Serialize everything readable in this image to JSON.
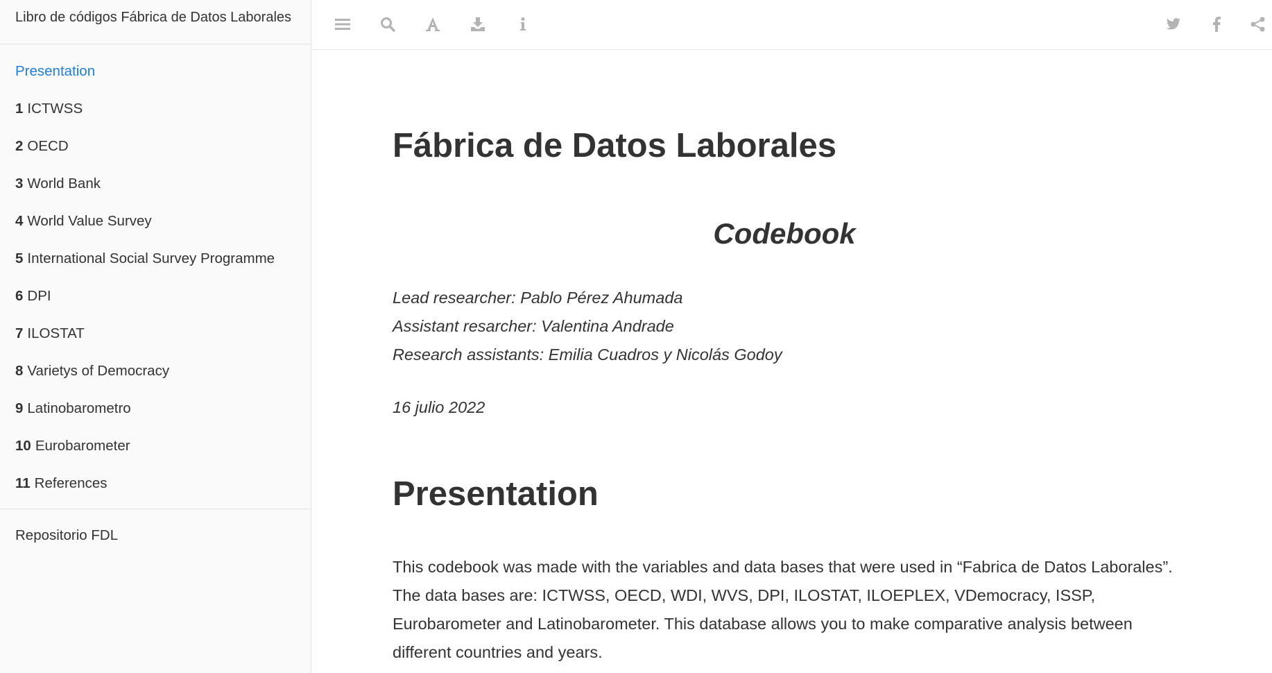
{
  "sidebar": {
    "title": "Libro de códigos Fábrica de Datos Laborales",
    "items": [
      {
        "num": "",
        "label": "Presentation",
        "active": true
      },
      {
        "num": "1",
        "label": "ICTWSS",
        "active": false
      },
      {
        "num": "2",
        "label": "OECD",
        "active": false
      },
      {
        "num": "3",
        "label": "World Bank",
        "active": false
      },
      {
        "num": "4",
        "label": "World Value Survey",
        "active": false
      },
      {
        "num": "5",
        "label": "International Social Survey Programme",
        "active": false
      },
      {
        "num": "6",
        "label": "DPI",
        "active": false
      },
      {
        "num": "7",
        "label": "ILOSTAT",
        "active": false
      },
      {
        "num": "8",
        "label": "Varietys of Democracy",
        "active": false
      },
      {
        "num": "9",
        "label": "Latinobarometro",
        "active": false
      },
      {
        "num": "10",
        "label": "Eurobarometer",
        "active": false
      },
      {
        "num": "11",
        "label": "References",
        "active": false
      }
    ],
    "repo_link": "Repositorio FDL"
  },
  "toolbar": {
    "left_icons": [
      "toggle-sidebar-icon",
      "search-icon",
      "font-settings-icon",
      "download-icon",
      "info-icon"
    ],
    "right_icons": [
      "twitter-icon",
      "facebook-icon",
      "share-icon"
    ]
  },
  "document": {
    "title": "Fábrica de Datos Laborales",
    "subtitle": "Codebook",
    "lead_researcher": "Lead researcher: Pablo Pérez Ahumada",
    "assistant_researcher": "Assistant resarcher: Valentina Andrade",
    "research_assistants": "Research assistants: Emilia Cuadros y Nicolás Godoy",
    "date": "16 julio 2022",
    "section_heading": "Presentation",
    "paragraph": "This codebook was made with the variables and data bases that were used in “Fabrica de Datos Laborales”. The data bases are: ICTWSS, OECD, WDI, WVS, DPI, ILOSTAT, ILOEPLEX, VDemocracy, ISSP, Eurobarometer and Latinobarometer. This database allows you to make comparative analysis between different countries and years."
  },
  "colors": {
    "accent": "#1f7ee0",
    "text": "#333333",
    "icon": "#b3b3b3",
    "sidebar_bg": "#fafafa"
  }
}
